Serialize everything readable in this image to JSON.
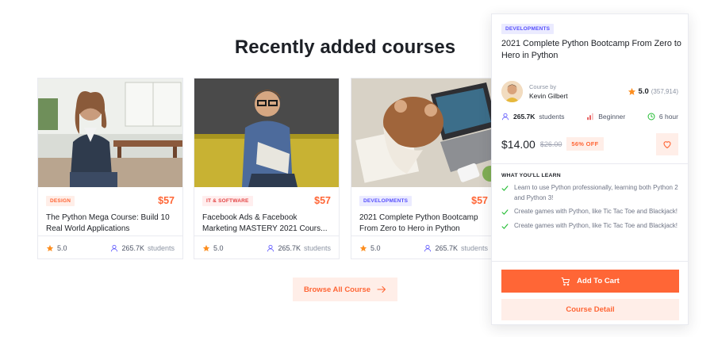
{
  "section": {
    "title": "Recently added courses"
  },
  "cards": [
    {
      "category": "DESIGN",
      "category_fg": "#ff6636",
      "category_bg": "#ffeee8",
      "price": "$57",
      "title": "The Python Mega Course: Build 10 Real World Applications",
      "rating": "5.0",
      "students_count": "265.7K",
      "students_label": "students"
    },
    {
      "category": "IT & SOFTWARE",
      "category_fg": "#e34444",
      "category_bg": "#ffeeee",
      "price": "$57",
      "title": "Facebook Ads & Facebook Marketing MASTERY 2021 Cours...",
      "rating": "5.0",
      "students_count": "265.7K",
      "students_label": "students"
    },
    {
      "category": "DEVELOPMENTS",
      "category_fg": "#564ffd",
      "category_bg": "#ebebff",
      "price": "$57",
      "title": "2021 Complete Python Bootcamp From Zero to Hero in Python",
      "rating": "5.0",
      "students_count": "265.7K",
      "students_label": "students"
    }
  ],
  "browse": {
    "label": "Browse All Course"
  },
  "popup": {
    "category": "DEVELOPMENTS",
    "title": "2021 Complete Python Bootcamp From Zero to Hero in Python",
    "course_by_label": "Course by",
    "author": "Kevin Gilbert",
    "rating": "5.0",
    "rating_count": "(357,914)",
    "students_count": "265.7K",
    "students_label": "students",
    "level": "Beginner",
    "duration": "6 hour",
    "price": "$14.00",
    "old_price": "$26.00",
    "discount": "56% OFF",
    "learn_heading": "WHAT YOU'LL LEARN",
    "learn_items": [
      "Learn to use Python professionally, learning both Python 2 and Python 3!",
      "Create games with Python, like Tic Tac Toe and Blackjack!",
      "Create games with Python, like Tic Tac Toe and Blackjack!"
    ],
    "add_to_cart": "Add To Cart",
    "course_detail": "Course Detail"
  },
  "colors": {
    "accent": "#ff6636",
    "accent_soft": "#ffeee8",
    "star": "#fd8e1f",
    "success": "#23bd33",
    "info": "#564ffd",
    "level": "#e34444"
  },
  "icons": {
    "star": "star-icon",
    "students": "user-icon",
    "arrow": "arrow-right-icon",
    "level": "bar-chart-icon",
    "clock": "clock-icon",
    "heart": "heart-icon",
    "check": "check-icon",
    "cart": "shopping-cart-icon"
  }
}
